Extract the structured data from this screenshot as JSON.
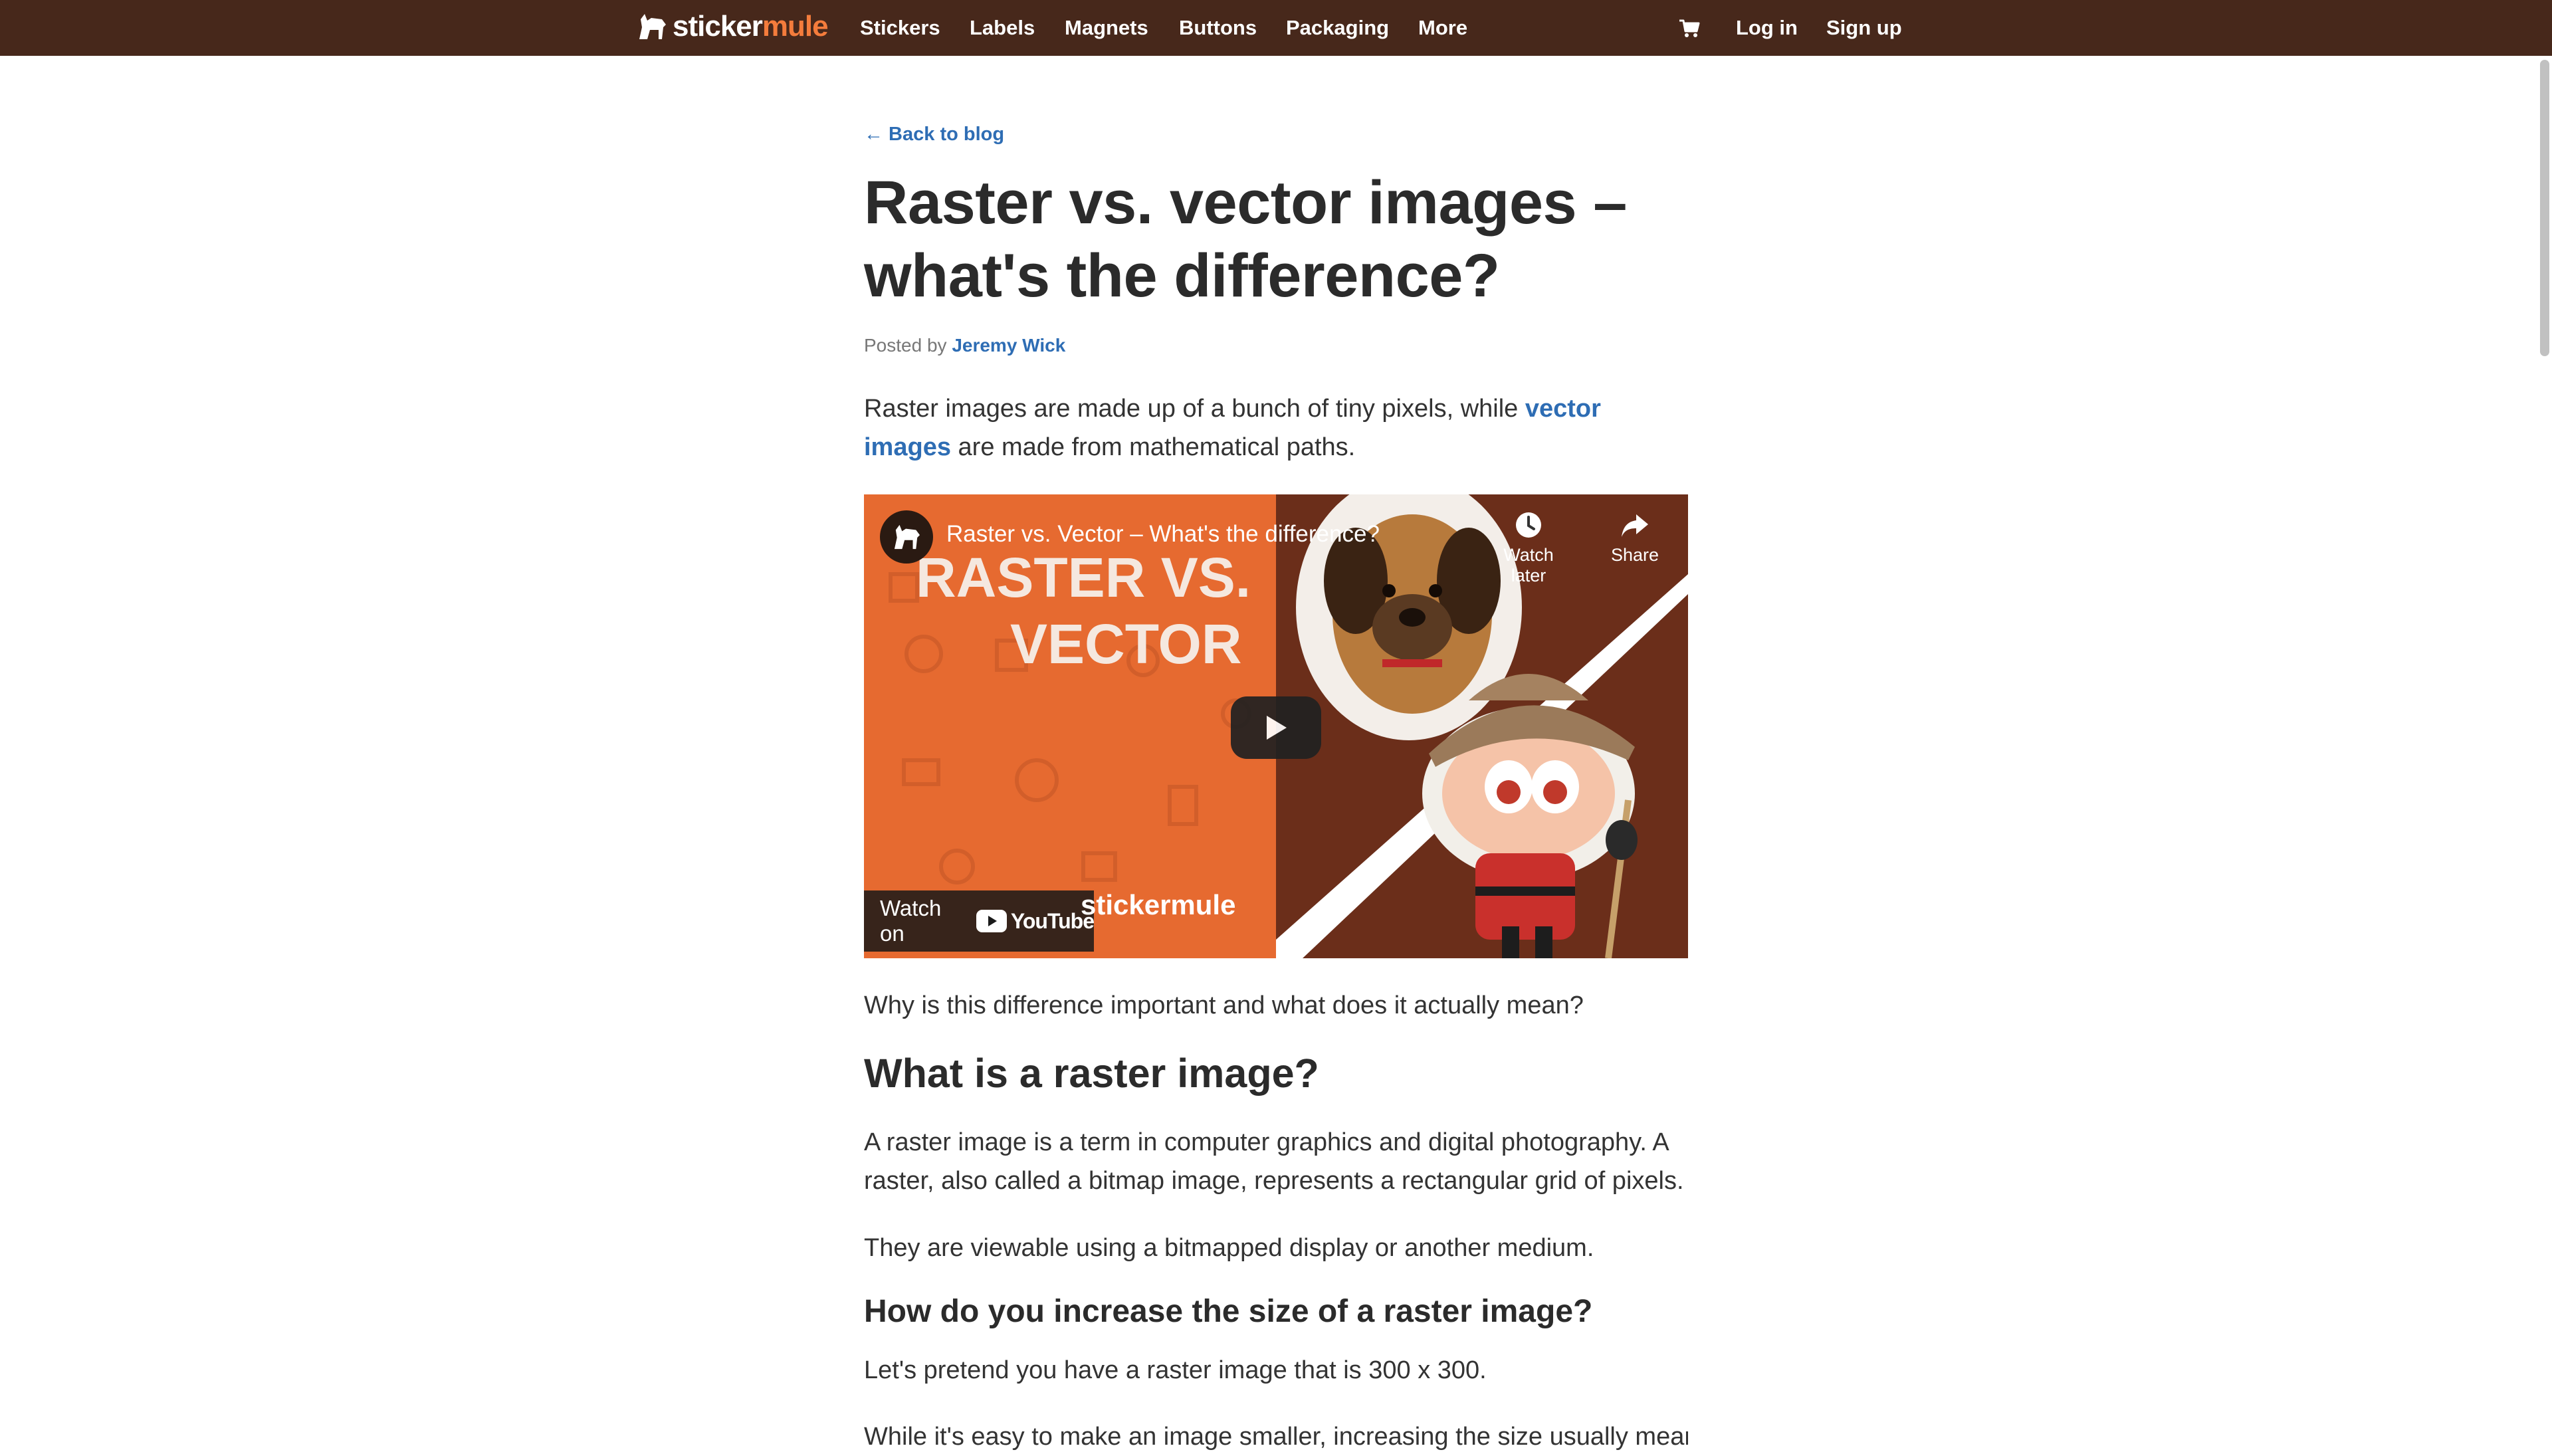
{
  "nav": {
    "logo_main": "sticker",
    "logo_accent": "mule",
    "items": [
      "Stickers",
      "Labels",
      "Magnets",
      "Buttons",
      "Packaging",
      "More"
    ],
    "cart_icon": "cart-icon",
    "login": "Log in",
    "signup": "Sign up"
  },
  "article": {
    "back_link": "← Back to blog",
    "title": "Raster vs. vector images – what's the difference?",
    "byline_prefix": "Posted by",
    "author": "Jeremy Wick",
    "intro_before": "Raster images are made up of a bunch of tiny pixels, while ",
    "intro_link": "vector images",
    "intro_after": " are made from mathematical paths.",
    "video": {
      "title": "Raster vs. Vector – What's the difference?",
      "thumb_line1": "RASTER VS.",
      "thumb_line2": "VECTOR",
      "watch_later": "Watch later",
      "share": "Share",
      "watch_on": "Watch on",
      "youtube": "YouTube",
      "brand": "stickermule"
    },
    "p_why": "Why is this difference important and what does it actually mean?",
    "h2_raster": "What is a raster image?",
    "p_raster_def": "A raster image is a term in computer graphics and digital photography. A raster, also called a bitmap image, represents a rectangular grid of pixels.",
    "p_viewable": "They are viewable using a bitmapped display or another medium.",
    "h3_increase": "How do you increase the size of a raster image?",
    "p_pretend": "Let's pretend you have a raster image that is 300 x 300.",
    "p_cutoff": "While it's easy to make an image smaller, increasing the size usually means"
  },
  "colors": {
    "nav_bg": "#47281b",
    "link": "#2e6db4",
    "logo_accent": "#f47c3c",
    "video_orange": "#e66a30"
  }
}
